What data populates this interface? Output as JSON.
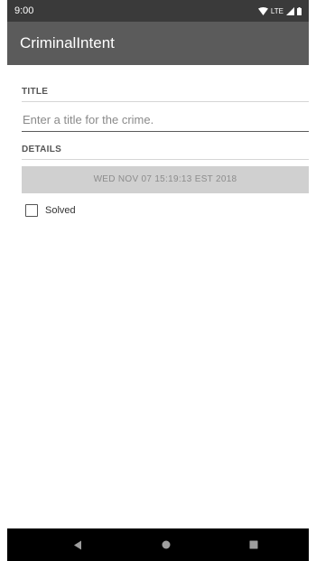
{
  "status_bar": {
    "time": "9:00",
    "network_label": "LTE",
    "icons": [
      "wifi-icon",
      "cellular-signal-icon",
      "battery-icon"
    ]
  },
  "app_bar": {
    "title": "CriminalIntent",
    "color": "#5b5b5b"
  },
  "title_section": {
    "header": "TITLE",
    "input_placeholder": "Enter a title for the crime.",
    "input_value": ""
  },
  "details_section": {
    "header": "DETAILS",
    "date_button_label": "WED NOV 07 15:19:13 EST 2018"
  },
  "solved_checkbox": {
    "label": "Solved",
    "checked": false
  },
  "nav_bar": {
    "buttons": [
      "back-icon",
      "home-icon",
      "recents-icon"
    ]
  }
}
